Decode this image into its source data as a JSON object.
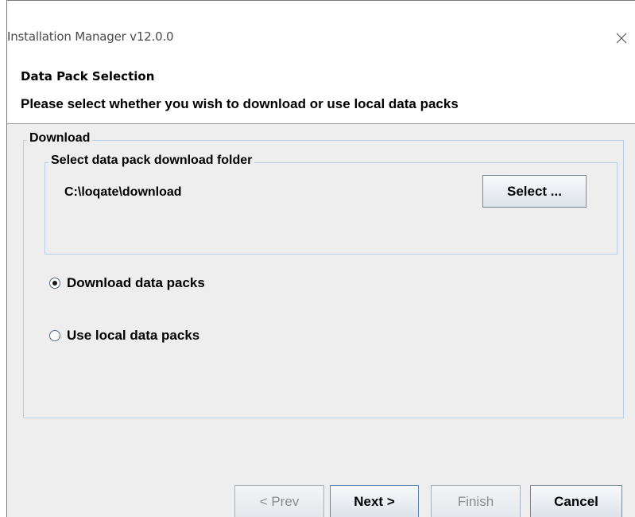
{
  "window": {
    "title": "Installation Manager v12.0.0",
    "close_icon": "close-icon"
  },
  "header": {
    "title": "Data Pack Selection",
    "subtitle": "Please select whether you wish to download or use local data packs"
  },
  "download_group": {
    "label": "Download",
    "folder_group": {
      "label": "Select data pack download folder",
      "path": "C:\\loqate\\download",
      "select_button": "Select ..."
    },
    "options": [
      {
        "label": "Download data packs",
        "selected": true
      },
      {
        "label": "Use local data packs",
        "selected": false
      }
    ]
  },
  "footer": {
    "prev": {
      "label": "< Prev",
      "enabled": false
    },
    "next": {
      "label": "Next >",
      "enabled": true
    },
    "finish": {
      "label": "Finish",
      "enabled": false
    },
    "cancel": {
      "label": "Cancel",
      "enabled": true
    }
  },
  "colors": {
    "content_bg": "#eeeeee",
    "group_border": "#b8cfe5",
    "disabled_text": "#8c8c8c"
  }
}
